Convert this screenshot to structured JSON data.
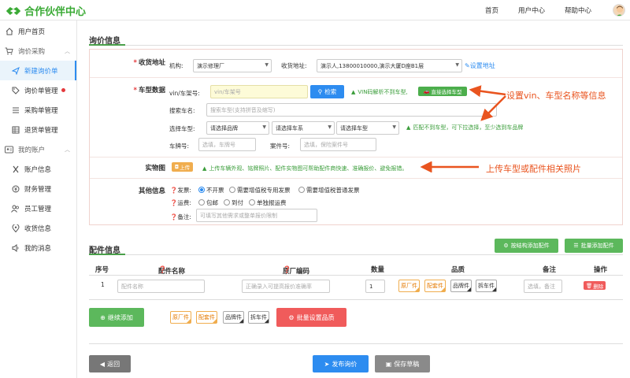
{
  "header": {
    "brand": "合作伙伴中心",
    "nav": [
      "首页",
      "用户中心",
      "帮助中心"
    ]
  },
  "sidebar": {
    "items": [
      {
        "label": "用户首页",
        "icon": "home-icon"
      },
      {
        "label": "询价采购",
        "icon": "cart-icon"
      },
      {
        "label": "新建询价单",
        "icon": "send-icon"
      },
      {
        "label": "询价单管理",
        "icon": "tag-icon"
      },
      {
        "label": "采购单管理",
        "icon": "list-icon"
      },
      {
        "label": "退货单管理",
        "icon": "table-icon"
      },
      {
        "label": "我的账户",
        "icon": "user-card-icon"
      },
      {
        "label": "账户信息",
        "icon": "tools-icon"
      },
      {
        "label": "财务管理",
        "icon": "coin-icon"
      },
      {
        "label": "员工管理",
        "icon": "people-icon"
      },
      {
        "label": "收货信息",
        "icon": "location-icon"
      },
      {
        "label": "我的消息",
        "icon": "speaker-icon"
      }
    ]
  },
  "inquiry": {
    "title": "询价信息",
    "address": {
      "label": "收货地址",
      "org_label": "机构:",
      "org_value": "演示修理厂",
      "addr_label": "收货地址:",
      "addr_value": "演示人,13800010000,演示大厦D座B1层",
      "set_link": "设置地址"
    },
    "vehicle": {
      "label": "车型数据",
      "vin_label": "vin/车架号:",
      "vin_placeholder": "vin/车架号",
      "search_btn": "检索",
      "vin_hint": "VIN码解析不到车型,",
      "select_model_btn": "直接选择车型",
      "search_model_label": "搜索车名:",
      "search_model_placeholder": "搜索车型(支持拼音及缩写)",
      "choose_label": "选择车型:",
      "brand_select": "请选择品牌",
      "series_select": "请选择车系",
      "model_select": "请选择车型",
      "choose_hint": "匹配不到车型，可下拉选择，至少选到车品牌",
      "plate_label": "车牌号:",
      "plate_placeholder": "选填，车牌号",
      "case_label": "案件号:",
      "case_placeholder": "选填，保险案件号"
    },
    "photo": {
      "label": "实物图",
      "upload_btn": "上传",
      "hint": "上传车辆外观、铭牌照片、配件实物图可帮助配件商快速、准确报价、避免报错。"
    },
    "other": {
      "label": "其他信息",
      "invoice_label": "发票:",
      "invoice_options": [
        "不开票",
        "需要增值税专用发票",
        "需要增值税普通发票"
      ],
      "freight_label": "运费:",
      "freight_options": [
        "包邮",
        "到付",
        "单独报运费"
      ],
      "note_label": "备注:",
      "note_placeholder": "可填写其他需求或整单报价限制"
    }
  },
  "annotations": {
    "vin": "设置vin、车型名称等信息",
    "photo": "上传车型或配件相关照片"
  },
  "parts": {
    "title": "配件信息",
    "add_by_structure": "按结构添加配件",
    "batch_add": "批量添加配件",
    "columns": [
      "序号",
      "配件名称",
      "原厂编码",
      "数量",
      "品质",
      "备注",
      "操作"
    ],
    "row": {
      "index": "1",
      "name_placeholder": "配件名称",
      "code_placeholder": "正确录入可提高报价准确率",
      "qty": "1",
      "note_placeholder": "选填，备注",
      "delete": "删除"
    },
    "qualities": [
      "原厂件",
      "配套件",
      "品牌件",
      "拆车件"
    ],
    "continue_add": "继续添加",
    "batch_quality": "批量设置品质"
  },
  "footer": {
    "back": "返回",
    "publish": "发布询价",
    "save_draft": "保存草稿"
  },
  "colors": {
    "brand": "#3aaa35",
    "primary": "#2d8cf0",
    "success": "#5cb85c",
    "danger": "#f05b5b",
    "annotation": "#e9541f"
  }
}
